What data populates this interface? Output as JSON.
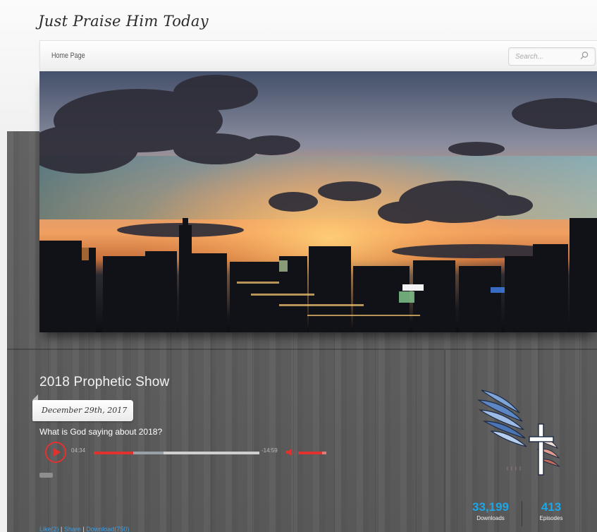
{
  "site": {
    "title": "Just Praise Him Today"
  },
  "nav": {
    "home_label": "Home Page"
  },
  "search": {
    "placeholder": "Search..."
  },
  "post": {
    "title": "2018 Prophetic Show",
    "date": "December 29th, 2017",
    "subtitle": "What is God saying about 2018?",
    "links": {
      "like": "Like(2)",
      "share": "Share",
      "download": "Download(750)",
      "separator": "|"
    }
  },
  "player": {
    "elapsed": "04:34",
    "remaining": "-14:59",
    "progress_fraction": 0.24,
    "buffered_fraction": 0.42,
    "volume_fraction": 0.85
  },
  "stats": {
    "downloads_value": "33,199",
    "downloads_label": "Downloads",
    "episodes_value": "413",
    "episodes_label": "Episodes"
  },
  "colors": {
    "accent_red": "#e0322f",
    "stat_blue": "#1aa6e8",
    "link_blue": "#3aa0e8",
    "wood_gray": "#5e5e5e"
  },
  "icons": [
    "search-icon",
    "play-icon",
    "volume-icon",
    "wing-cross-logo"
  ]
}
